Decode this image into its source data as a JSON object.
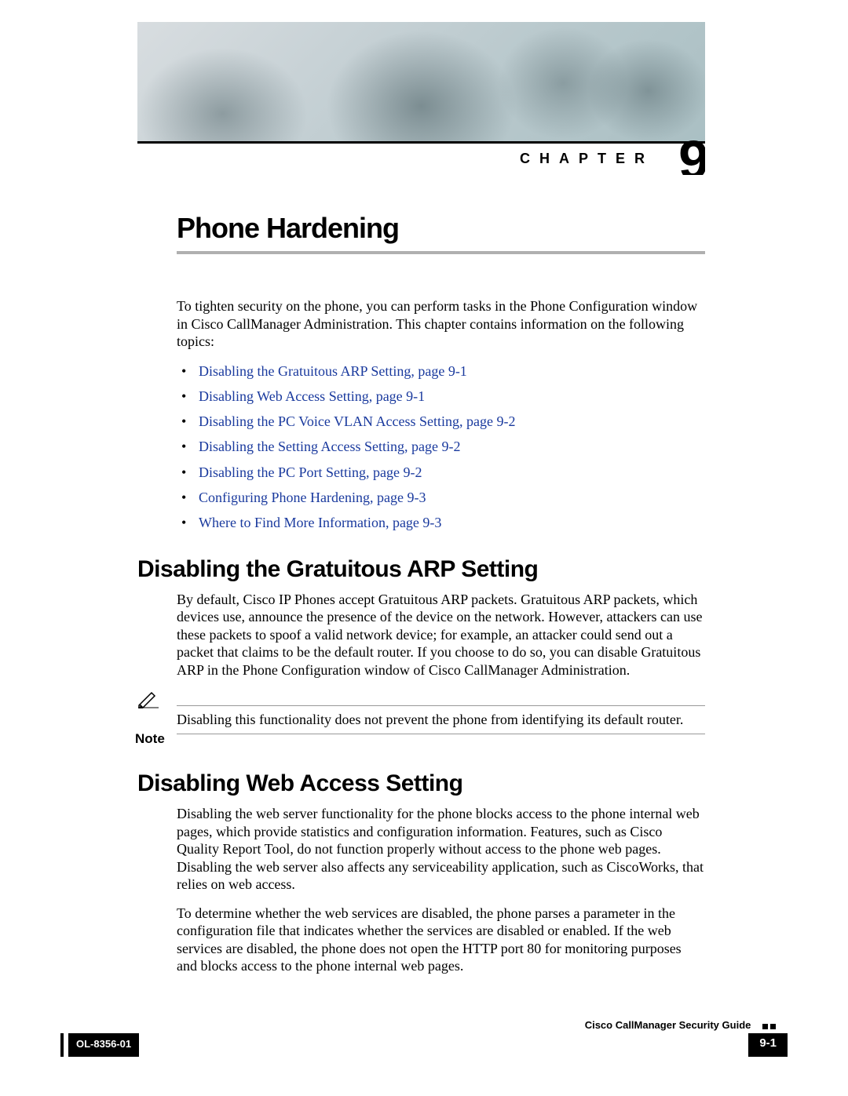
{
  "chapter": {
    "label": "CHAPTER",
    "number": "9",
    "title": "Phone Hardening"
  },
  "intro": "To tighten security on the phone, you can perform tasks in the Phone Configuration window in Cisco CallManager Administration. This chapter contains information on the following topics:",
  "links": [
    "Disabling the Gratuitous ARP Setting, page 9-1",
    "Disabling Web Access Setting, page 9-1",
    "Disabling the PC Voice VLAN Access Setting, page 9-2",
    "Disabling the Setting Access Setting, page 9-2",
    "Disabling the PC Port Setting, page 9-2",
    "Configuring Phone Hardening, page 9-3",
    "Where to Find More Information, page 9-3"
  ],
  "section1": {
    "title": "Disabling the Gratuitous ARP Setting",
    "body": "By default, Cisco IP Phones accept Gratuitous ARP packets. Gratuitous ARP packets, which devices use, announce the presence of the device on the network. However, attackers can use these packets to spoof a valid network device; for example, an attacker could send out a packet that claims to be the default router. If you choose to do so, you can disable Gratuitous ARP in the Phone Configuration window of Cisco CallManager Administration.",
    "note_label": "Note",
    "note_text": "Disabling this functionality does not prevent the phone from identifying its default router."
  },
  "section2": {
    "title": "Disabling Web Access Setting",
    "body1": "Disabling the web server functionality for the phone blocks access to the phone internal web pages, which provide statistics and configuration information. Features, such as Cisco Quality Report Tool, do not function properly without access to the phone web pages. Disabling the web server also affects any serviceability application, such as CiscoWorks, that relies on web access.",
    "body2": "To determine whether the web services are disabled, the phone parses a parameter in the configuration file that indicates whether the services are disabled or enabled. If the web services are disabled, the phone does not open the HTTP port 80 for monitoring purposes and blocks access to the phone internal web pages."
  },
  "footer": {
    "guide": "Cisco CallManager Security Guide",
    "doc": "OL-8356-01",
    "page": "9-1"
  }
}
